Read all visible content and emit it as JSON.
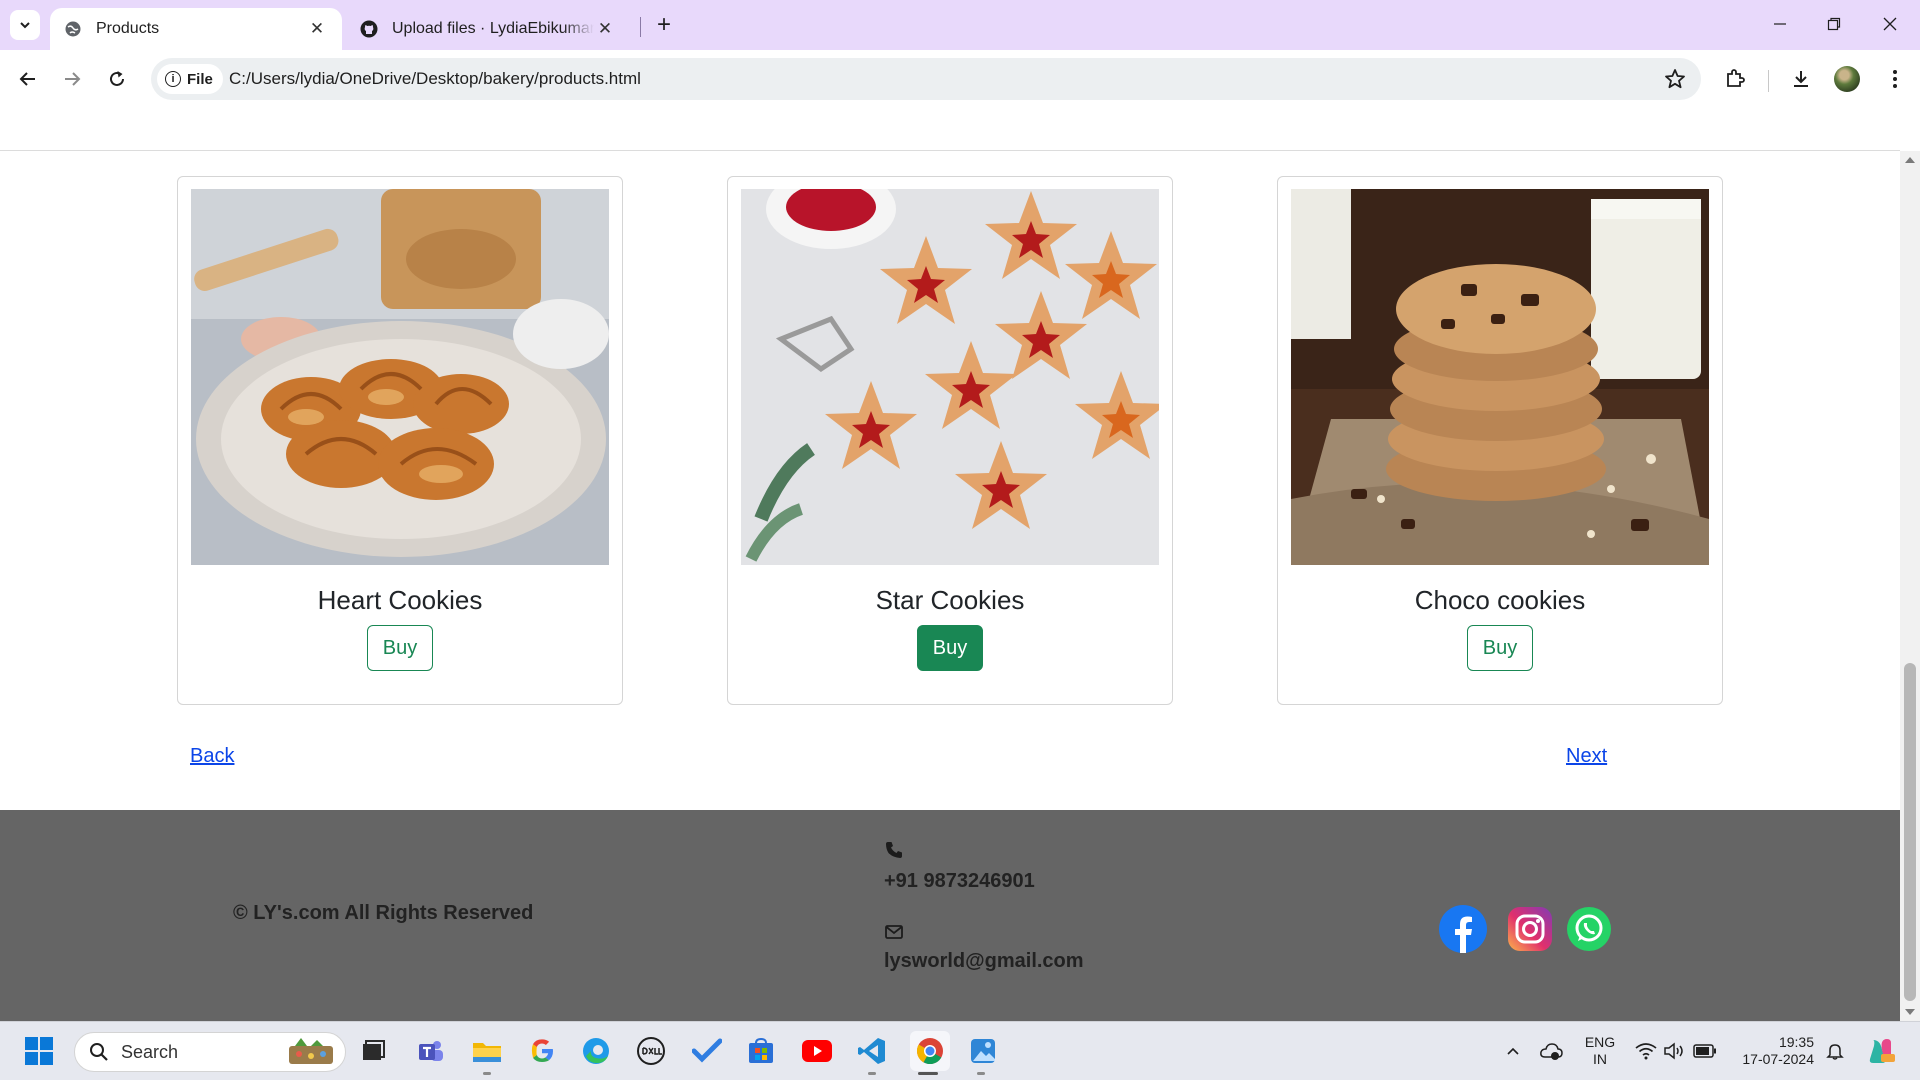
{
  "browser": {
    "tabs": [
      {
        "title": "Products",
        "active": true
      },
      {
        "title": "Upload files · LydiaEbikumar/Sta",
        "active": false
      }
    ],
    "chip_label": "File",
    "url": "C:/Users/lydia/OneDrive/Desktop/bakery/products.html"
  },
  "products": [
    {
      "name": "Heart Cookies",
      "button": "Buy",
      "style": "outline"
    },
    {
      "name": "Star Cookies",
      "button": "Buy",
      "style": "filled"
    },
    {
      "name": "Choco cookies",
      "button": "Buy",
      "style": "outline"
    }
  ],
  "pagination": {
    "back": "Back",
    "next": "Next"
  },
  "footer": {
    "copyright": "© LY's.com All Rights Reserved",
    "phone": "+91 9873246901",
    "email": "lysworld@gmail.com",
    "social": [
      "facebook-icon",
      "instagram-icon",
      "whatsapp-icon"
    ]
  },
  "taskbar": {
    "search_placeholder": "Search",
    "lang_line1": "ENG",
    "lang_line2": "IN",
    "time": "19:35",
    "date": "17-07-2024"
  },
  "colors": {
    "tabstrip": "#e8d9fb",
    "buy_green": "#198754",
    "link_blue": "#0b45e8",
    "footer_bg": "#656565"
  }
}
